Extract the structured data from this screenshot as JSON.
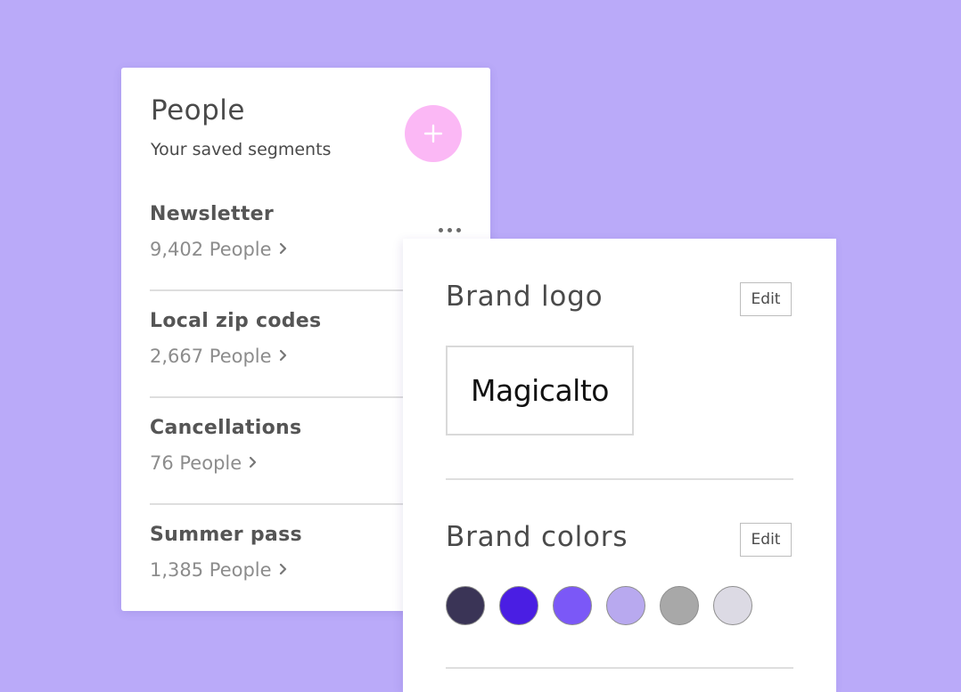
{
  "people": {
    "title": "People",
    "subtitle": "Your saved segments",
    "add_icon": "plus-icon",
    "more_icon": "ellipsis-icon",
    "segments": [
      {
        "name": "Newsletter",
        "count": "9,402 People"
      },
      {
        "name": "Local zip codes",
        "count": "2,667 People"
      },
      {
        "name": "Cancellations",
        "count": "76 People"
      },
      {
        "name": "Summer pass",
        "count": "1,385 People"
      }
    ]
  },
  "brand": {
    "logo_heading": "Brand logo",
    "logo_edit_label": "Edit",
    "logo_text": "Magicalto",
    "colors_heading": "Brand colors",
    "colors_edit_label": "Edit",
    "colors": [
      "#3a3456",
      "#4a1ee3",
      "#7b58f7",
      "#b8a9ef",
      "#a8a8a8",
      "#dcdae4"
    ]
  },
  "theme": {
    "background": "#baaaf9",
    "add_button": "#fbb8f5"
  }
}
